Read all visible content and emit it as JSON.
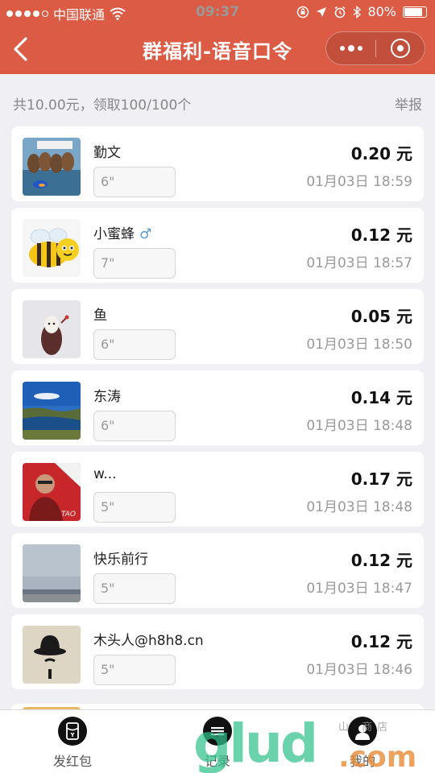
{
  "status_bar": {
    "carrier": "中国联通",
    "time": "09:37",
    "battery": "80%"
  },
  "nav": {
    "title": "群福利-语音口令"
  },
  "summary": {
    "text": "共10.00元，领取100/100个",
    "report": "举报"
  },
  "records": [
    {
      "name": "勤文",
      "voice": "6\"",
      "amount": "0.20 元",
      "time": "01月03日 18:59",
      "gender": ""
    },
    {
      "name": "小蜜蜂",
      "voice": "7\"",
      "amount": "0.12 元",
      "time": "01月03日 18:57",
      "gender": "♂"
    },
    {
      "name": "鱼",
      "voice": "6\"",
      "amount": "0.05 元",
      "time": "01月03日 18:50",
      "gender": ""
    },
    {
      "name": "东涛",
      "voice": "6\"",
      "amount": "0.14 元",
      "time": "01月03日 18:48",
      "gender": ""
    },
    {
      "name": "w...",
      "voice": "5\"",
      "amount": "0.17 元",
      "time": "01月03日 18:48",
      "gender": ""
    },
    {
      "name": "快乐前行",
      "voice": "5\"",
      "amount": "0.12 元",
      "time": "01月03日 18:47",
      "gender": ""
    },
    {
      "name": "木头人@h8h8.cn",
      "voice": "5\"",
      "amount": "0.12 元",
      "time": "01月03日 18:46",
      "gender": ""
    }
  ],
  "tabbar": {
    "tabs": [
      {
        "label": "发红包"
      },
      {
        "label": "记录"
      },
      {
        "label": "我的"
      }
    ]
  },
  "watermark": {
    "main": "glud",
    "suffix": ".com",
    "small": "山 商店"
  }
}
